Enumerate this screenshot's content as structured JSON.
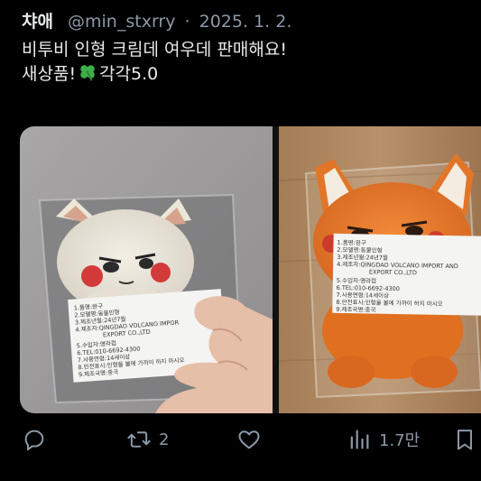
{
  "tweet": {
    "author_name": "챠애",
    "handle": "@min_stxrry",
    "separator": "·",
    "date": "2025. 1. 2.",
    "text_line1": "비투비 인형 크림데 여우데 판매해요!",
    "text_line2_before": "새상품!",
    "text_line2_after": "각각5.0",
    "emoji": "four-leaf-clover-icon"
  },
  "media": {
    "left_label": {
      "lines": [
        "1.품명:완구",
        "2.모델명:동물인형",
        "3.제조년월:24년7월",
        "4.제조자:QINGDAO VOLCANO IMPOR",
        "EXPORT CO.,LTD",
        "5.수입자:영라컴",
        "6.TEL:010-6692-4300",
        "7.사용연령:14세이상",
        "8.안전표시:인형을 불에 가까이 하지 마시오",
        "9.제조국명:중국"
      ]
    },
    "right_label": {
      "lines": [
        "1.품명:완구",
        "2.모델명:동물인형",
        "3.제조년월:24년7월",
        "4.제조자:QINGDAO VOLCANO IMPORT AND",
        "EXPORT CO.,LTD",
        "5.수입자:영라컴",
        "6.TEL:010-6692-4300",
        "7.사용연령:14세이상",
        "8.안전표시:인형을 불에 가까이 하지 마시오",
        "9.제조국명:중국"
      ]
    }
  },
  "actions": {
    "reply_icon": "reply-icon",
    "retweet_icon": "retweet-icon",
    "retweet_count": "2",
    "like_icon": "heart-icon",
    "views_icon": "views-icon",
    "views_count": "1.7만",
    "bookmark_icon": "bookmark-icon"
  },
  "colors": {
    "background": "#000000",
    "text": "#e7e9ea",
    "secondary": "#8b98a5",
    "clover": "#3fae4a"
  }
}
